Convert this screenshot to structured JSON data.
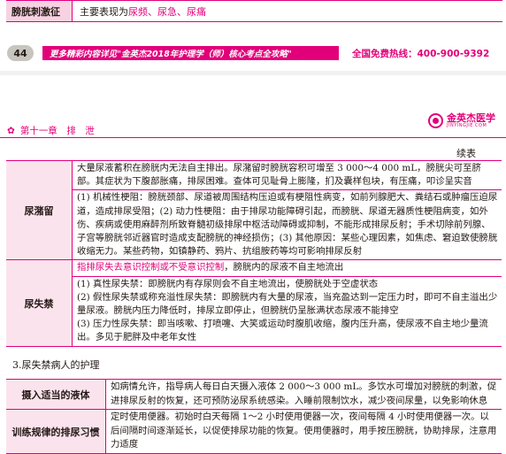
{
  "top_row": {
    "label": "膀胱刺激征",
    "value_prefix": "主要表现为",
    "symptoms": "尿频、尿急、尿痛"
  },
  "footer": {
    "page_number": "44",
    "banner": "更多精彩内容详见\"金英杰2018年护理学（师）核心考点全攻略\"",
    "hotline": "全国免费热线：400-900-9392"
  },
  "chapter": {
    "star": "✿",
    "title": "第十一章　排　泄",
    "logo_name": "金英杰医学",
    "logo_sub": "JINYINGJIE.COM"
  },
  "continued_label": "续表",
  "main_table": [
    {
      "label": "尿潴留",
      "cells": [
        "大量尿液蓄积在膀胱内无法自主排出。尿潴留时膀胱容积可增至 3 000～4 000 mL，膀胱尖可至脐部。其症状为下腹部胀痛，排尿困难。查体可见耻骨上膨隆，扪及囊样包块，有压痛，叩诊呈实音",
        "(1) 机械性梗阻：膀胱颈部、尿道被周围结构压迫或有梗阻性病变，如前列腺肥大、粪结石或肿瘤压迫尿道，造成排尿受阻；(2) 动力性梗阻：由于排尿功能障碍引起，而膀胱、尿道无器质性梗阻病变，如外伤、疾病或使用麻醉剂所致脊髓初级排尿中枢活动障碍或抑制，不能形成排尿反射；手术切除前列腺、子宫等膀胱邻近器官时造成支配膀胱的神经损伤；(3) 其他原因：某些心理因素，如焦虑、窘迫致使膀胱收缩无力。某些药物，如镇静药、鸦片、抗组胺药等均可影响排尿反射"
      ]
    },
    {
      "label": "尿失禁",
      "cells": [
        {
          "emph": "指排尿失去意识控制或不受意识控制",
          "rest": "，膀胱内的尿液不自主地流出"
        },
        "(1) 真性尿失禁：即膀胱内有存尿则会不自主地流出，使膀胱处于空虚状态\n(2) 假性尿失禁或称充溢性尿失禁：即膀胱内有大量的尿液，当充盈达到一定压力时，即可不自主溢出少量尿液。膀胱内压力降低时，排尿立即停止，但膀胱仍呈胀满状态尿液不能排空\n(3) 压力性尿失禁：即当咳嗽、打喷嚏、大笑或运动时腹肌收缩，腹内压升高，使尿液不自主地少量流出。多见于肥胖及中老年女性"
      ]
    }
  ],
  "section_title": "3.尿失禁病人的护理",
  "care_table": [
    {
      "label": "摄入适当的液体",
      "text": "如病情允许，指导病人每日白天摄入液体 2 000～3 000 mL。多饮水可增加对膀胱的刺激，促进排尿反射的恢复，还可预防泌尿系统感染。入睡前限制饮水，减少夜间尿量，以免影响休息"
    },
    {
      "label": "训练规律的排尿习惯",
      "text": "定时使用便器。初始时白天每隔 1～2 小时使用便器一次，夜间每隔 4 小时使用便器一次。以后间隔时间逐渐延长，以促使排尿功能的恢复。使用便器时，用手按压膀胱，协助排尿，注意用力适度"
    }
  ],
  "colors": {
    "accent": "#e2007a",
    "label_fill": "#fbe3ee"
  }
}
